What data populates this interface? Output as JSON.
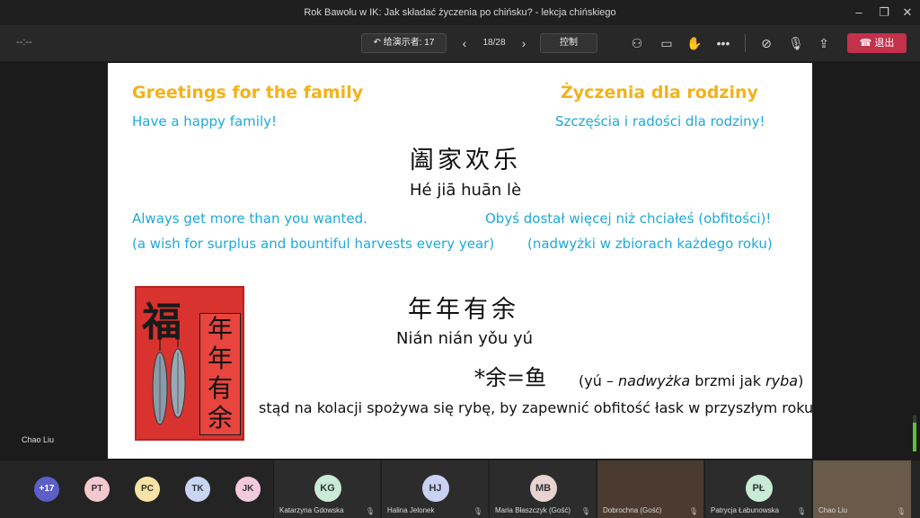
{
  "window": {
    "title": "Rok Bawołu w IK: Jak składać życzenia po chińsku? - lekcja chińskiego"
  },
  "toolbar": {
    "timer": "--:--",
    "back_label": "给演示者: 17",
    "page_counter": "18/28",
    "control_label": "控制",
    "leave_label": "退出"
  },
  "slide": {
    "heading_en": "Greetings for the family",
    "heading_pl": "Życzenia dla rodziny",
    "line1_en": "Have a happy family!",
    "line1_pl": "Szczęścia i radości dla rodziny!",
    "phrase1_hanzi": "阖家欢乐",
    "phrase1_pinyin": "Hé jiā huān lè",
    "line2_en": "Always get more than you wanted.",
    "line2_pl": "Obyś dostał więcej niż chciałeś (obfitości)!",
    "line3_en": "(a wish for surplus and bountiful harvests every year)",
    "line3_pl": "(nadwyżki w zbiorach każdego roku)",
    "phrase2_hanzi": "年年有余",
    "phrase2_pinyin": "Nián nián yǒu yú",
    "equation": "*余=鱼",
    "note_prefix": "(yú – ",
    "note_italic1": "nadwyżka",
    "note_mid": " brzmi jak ",
    "note_italic2": "ryba",
    "note_suffix": ")",
    "bottom_text": "stąd na kolacji spożywa się rybę, by zapewnić obfitość łask w przyszłym roku",
    "poster_big_char": "福",
    "poster_vertical": "年年有余"
  },
  "presenter_name": "Chao Liu",
  "mic_level": 0.8,
  "participants": {
    "overflow": "+17",
    "avatars": [
      {
        "initials": "PT",
        "color": "#f3c9cf"
      },
      {
        "initials": "PC",
        "color": "#f6e3a5"
      },
      {
        "initials": "TK",
        "color": "#c9d6f2"
      },
      {
        "initials": "JK",
        "color": "#f3c9dc"
      }
    ],
    "tiles": [
      {
        "initials": "KG",
        "name": "Katarzyna Gdowska",
        "color": "#c8ead6"
      },
      {
        "initials": "HJ",
        "name": "Halina Jelonek",
        "color": "#c9d2f3"
      },
      {
        "initials": "MB",
        "name": "Maria Błaszczyk (Gość)",
        "color": "#e8d2d2"
      },
      {
        "initials": "",
        "name": "Dobrochna (Gość)",
        "color": "#4a3a30"
      },
      {
        "initials": "PŁ",
        "name": "Patrycja Łabunowska",
        "color": "#c8ead6"
      },
      {
        "initials": "",
        "name": "Chao Liu",
        "color": "#6a5a4a"
      }
    ]
  },
  "colors": {
    "accent_gold": "#f2b21b",
    "accent_cyan": "#1fa9d6",
    "leave_red": "#c4314b"
  }
}
